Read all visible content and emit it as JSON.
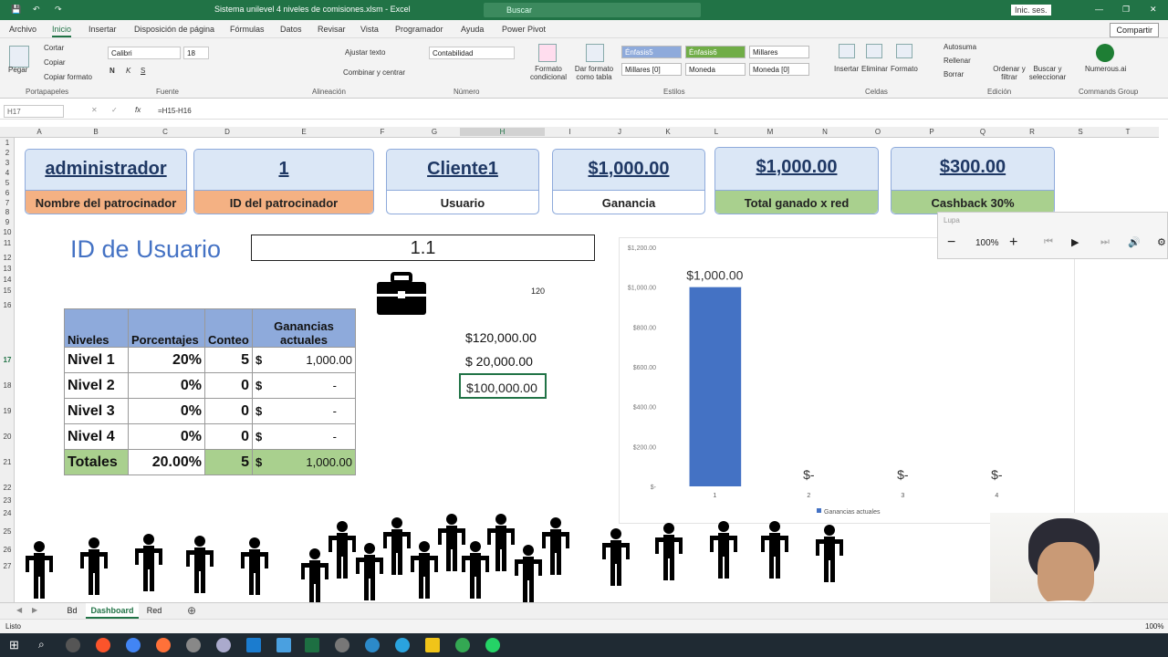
{
  "window": {
    "title": "Sistema unilevel 4 niveles de comisiones.xlsm - Excel",
    "search": "Buscar",
    "signin": "Inic. ses.",
    "share": "Compartir"
  },
  "menu": [
    "Archivo",
    "Inicio",
    "Insertar",
    "Disposición de página",
    "Fórmulas",
    "Datos",
    "Revisar",
    "Vista",
    "Programador",
    "Ayuda",
    "Power Pivot"
  ],
  "ribbon": {
    "clipboard": {
      "paste": "Pegar",
      "cut": "Cortar",
      "copy": "Copiar",
      "format_painter": "Copiar formato",
      "group": "Portapapeles"
    },
    "font": {
      "name": "Calibri",
      "size": "18",
      "group": "Fuente",
      "bold": "N",
      "italic": "K",
      "underline": "S"
    },
    "alignment": {
      "wrap": "Ajustar texto",
      "merge": "Combinar y centrar",
      "group": "Alineación"
    },
    "number": {
      "format": "Contabilidad",
      "group": "Número"
    },
    "styles": {
      "cond": "Formato condicional",
      "table": "Dar formato como tabla",
      "group": "Estilos",
      "cells": [
        "Énfasis5",
        "Énfasis6",
        "Millares",
        "Millares [0]",
        "Moneda",
        "Moneda [0]"
      ]
    },
    "cells": {
      "insert": "Insertar",
      "delete": "Eliminar",
      "format": "Formato",
      "group": "Celdas"
    },
    "editing": {
      "autosum": "Autosuma",
      "fill": "Rellenar",
      "clear": "Borrar",
      "sort": "Ordenar y filtrar",
      "find": "Buscar y seleccionar",
      "group": "Edición"
    },
    "addin": {
      "name": "Numerous.ai",
      "group": "Commands Group"
    }
  },
  "formula_bar": {
    "cell": "H17",
    "formula": "=H15-H16"
  },
  "columns": [
    "A",
    "B",
    "C",
    "D",
    "E",
    "F",
    "G",
    "H",
    "I",
    "J",
    "K",
    "L",
    "M",
    "N",
    "O",
    "P",
    "Q",
    "R",
    "S",
    "T"
  ],
  "rows": [
    "1",
    "2",
    "3",
    "4",
    "5",
    "6",
    "7",
    "8",
    "9",
    "10",
    "11",
    "12",
    "13",
    "14",
    "15",
    "16",
    "17",
    "18",
    "19",
    "20",
    "21",
    "22",
    "23",
    "24",
    "25",
    "26",
    "27"
  ],
  "cards": [
    {
      "value": "administrador",
      "label": "Nombre del patrocinador"
    },
    {
      "value": "1",
      "label": "ID del patrocinador"
    },
    {
      "value": "Cliente1",
      "label": "Usuario"
    },
    {
      "value": "$1,000.00",
      "label": "Ganancia"
    },
    {
      "value": "$1,000.00",
      "label": "Total ganado x red"
    },
    {
      "value": "$300.00",
      "label": "Cashback 30%"
    }
  ],
  "user_id": {
    "label": "ID de Usuario",
    "value": "1.1"
  },
  "calc": {
    "small": "120",
    "a": "$120,000.00",
    "b": "$  20,000.00",
    "c": "$100,000.00"
  },
  "levels": {
    "headers": [
      "Niveles",
      "Porcentajes",
      "Conteo",
      "Ganancias actuales"
    ],
    "rows": [
      {
        "n": "Nivel 1",
        "p": "20%",
        "c": "5",
        "cur": "$",
        "g": "1,000.00"
      },
      {
        "n": "Nivel 2",
        "p": "0%",
        "c": "0",
        "cur": "$",
        "g": "-"
      },
      {
        "n": "Nivel 3",
        "p": "0%",
        "c": "0",
        "cur": "$",
        "g": "-"
      },
      {
        "n": "Nivel 4",
        "p": "0%",
        "c": "0",
        "cur": "$",
        "g": "-"
      }
    ],
    "total": {
      "n": "Totales",
      "p": "20.00%",
      "c": "5",
      "cur": "$",
      "g": "1,000.00"
    }
  },
  "chart_data": {
    "type": "bar",
    "categories": [
      "1",
      "2",
      "3",
      "4"
    ],
    "series": [
      {
        "name": "Ganancias actuales",
        "values": [
          1000,
          0,
          0,
          0
        ]
      }
    ],
    "data_labels": [
      "$1,000.00",
      "$-",
      "$-",
      "$-"
    ],
    "yticks": [
      "$1,200.00",
      "$1,000.00",
      "$800.00",
      "$600.00",
      "$400.00",
      "$200.00",
      "$-"
    ],
    "ylim": [
      0,
      1200
    ],
    "legend": "bottom",
    "color": "#4472c4"
  },
  "magnifier": {
    "title": "Lupa",
    "zoom": "100%"
  },
  "sheets": [
    "Bd",
    "Dashboard",
    "Red"
  ],
  "status": {
    "ready": "Listo",
    "zoom": "100%"
  }
}
